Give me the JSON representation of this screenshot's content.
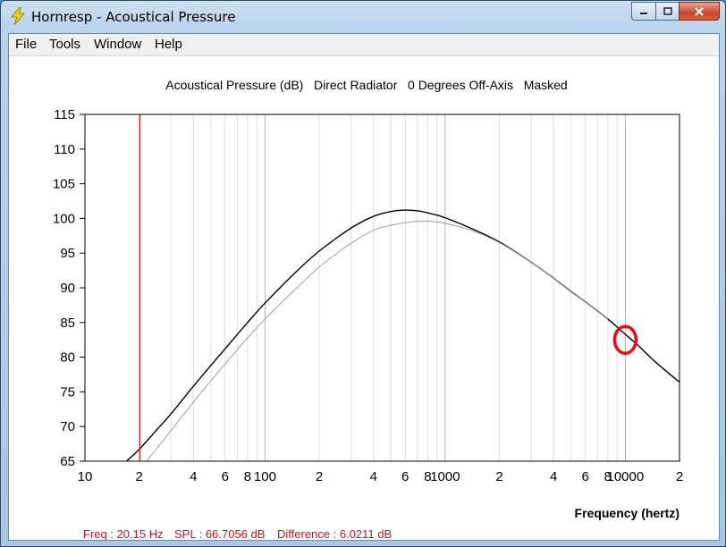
{
  "window": {
    "title": "Hornresp - Acoustical Pressure",
    "controls": [
      "minimize",
      "maximize",
      "close"
    ]
  },
  "menu": {
    "file": "File",
    "tools": "Tools",
    "window": "Window",
    "help": "Help"
  },
  "status": {
    "freq": "Freq : 20.15 Hz",
    "spl": "SPL : 66.7056 dB",
    "difference": "Difference : 6.0211 dB"
  },
  "colors": {
    "main_curve": "#000000",
    "secondary_curve": "#a0a0a0",
    "cursor_line": "#c8141e",
    "marker_circle": "#e0101a",
    "status_text": "#c8141e"
  },
  "chart_data": {
    "type": "line",
    "title": "Acoustical Pressure (dB)   Direct Radiator   0 Degrees Off-Axis   Masked",
    "xlabel": "Frequency (hertz)",
    "ylabel": "",
    "x_scale": "log",
    "xlim": [
      10,
      20000
    ],
    "ylim": [
      65,
      115
    ],
    "yticks": [
      115,
      110,
      105,
      100,
      95,
      90,
      85,
      80,
      75,
      70,
      65
    ],
    "xtick_labels": [
      {
        "value": 10,
        "label": "10"
      },
      {
        "value": 20,
        "label": "2"
      },
      {
        "value": 40,
        "label": "4"
      },
      {
        "value": 60,
        "label": "6"
      },
      {
        "value": 80,
        "label": "8"
      },
      {
        "value": 100,
        "label": "100"
      },
      {
        "value": 200,
        "label": "2"
      },
      {
        "value": 400,
        "label": "4"
      },
      {
        "value": 600,
        "label": "6"
      },
      {
        "value": 800,
        "label": "8"
      },
      {
        "value": 1000,
        "label": "1000"
      },
      {
        "value": 2000,
        "label": "2"
      },
      {
        "value": 4000,
        "label": "4"
      },
      {
        "value": 6000,
        "label": "6"
      },
      {
        "value": 8000,
        "label": "8"
      },
      {
        "value": 10000,
        "label": "10000"
      },
      {
        "value": 20000,
        "label": "2"
      }
    ],
    "grid": true,
    "cursor_frequency": 20.15,
    "marker_point": {
      "x": 10000,
      "y": 82.5
    },
    "series": [
      {
        "x": [
          17,
          20,
          25,
          30,
          40,
          50,
          60,
          80,
          100,
          150,
          200,
          300,
          400,
          500,
          600,
          700,
          800,
          1000,
          1500,
          2000,
          3000,
          4000,
          5000,
          6000,
          8000,
          10000,
          12000,
          15000,
          20000
        ],
        "y": [
          65.0,
          66.7,
          69.5,
          71.8,
          75.8,
          78.8,
          81.2,
          85.0,
          87.8,
          92.4,
          95.3,
          98.6,
          100.3,
          101.0,
          101.2,
          101.1,
          100.8,
          100.1,
          98.2,
          96.6,
          93.7,
          91.4,
          89.5,
          88.0,
          85.5,
          83.3,
          81.5,
          79.1,
          76.4
        ]
      },
      {
        "x": [
          22,
          25,
          30,
          40,
          50,
          60,
          80,
          100,
          150,
          200,
          300,
          400,
          500,
          600,
          700,
          800,
          900,
          1000,
          1200,
          1500,
          2000,
          3000,
          4000,
          6000,
          8000
        ],
        "y": [
          65.0,
          66.8,
          69.4,
          73.5,
          76.6,
          79.0,
          82.8,
          85.5,
          90.0,
          93.0,
          96.4,
          98.3,
          99.0,
          99.4,
          99.6,
          99.6,
          99.5,
          99.3,
          98.8,
          98.0,
          96.5,
          93.7,
          91.4,
          88.0,
          85.5
        ]
      }
    ]
  }
}
